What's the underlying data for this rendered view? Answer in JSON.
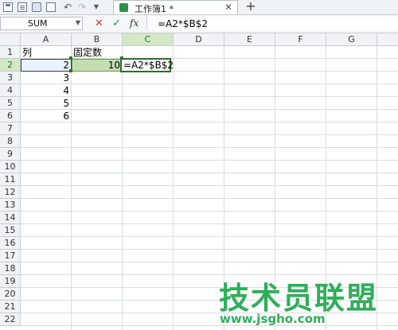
{
  "toolbar": {
    "icons": [
      "save-icon",
      "document-icon",
      "print-icon",
      "print-preview-icon",
      "undo-icon",
      "redo-icon",
      "more-icon"
    ],
    "undo_glyph": "↶",
    "redo_glyph": "↷",
    "more_glyph": "▼"
  },
  "tab": {
    "title": "工作簿1 *",
    "close_glyph": "✕",
    "new_tab_glyph": "+"
  },
  "formula_bar": {
    "name_box": "SUM",
    "name_box_arrow": "▼",
    "cancel_glyph": "✕",
    "enter_glyph": "✓",
    "fx_label": "fx",
    "formula": "=A2*$B$2"
  },
  "columns": [
    "A",
    "B",
    "C",
    "D",
    "E",
    "F",
    "G"
  ],
  "rows": [
    "1",
    "2",
    "3",
    "4",
    "5",
    "6",
    "7",
    "8",
    "9",
    "10",
    "11",
    "12",
    "13",
    "14",
    "15",
    "16",
    "17",
    "18",
    "19",
    "20",
    "21",
    "22"
  ],
  "active_column": "C",
  "active_row": "2",
  "cells": {
    "A1": "列",
    "B1": "固定数",
    "A2": "2",
    "B2": "10",
    "C2": "=A2*$B$2",
    "A3": "3",
    "A4": "4",
    "A5": "5",
    "A6": "6"
  },
  "watermark": {
    "title": "技术员联盟",
    "url": "www.jsgho.com"
  },
  "colors": {
    "accent_green": "#2fae5a",
    "selection_green": "#c4ddb3",
    "header_active": "#d2e8c6"
  }
}
